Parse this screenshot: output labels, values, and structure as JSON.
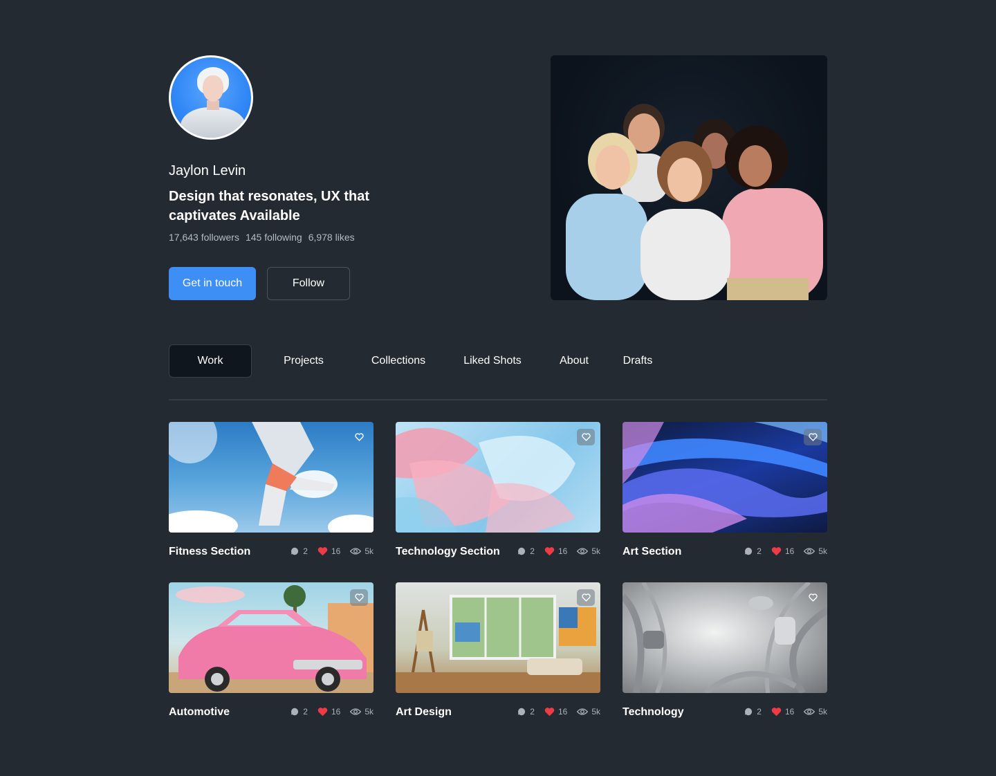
{
  "profile": {
    "name": "Jaylon Levin",
    "tagline": "Design that resonates, UX that captivates Available",
    "followers": "17,643 followers",
    "following": "145 following",
    "likes": "6,978 likes",
    "primary_button": "Get in touch",
    "secondary_button": "Follow"
  },
  "tabs": [
    "Work",
    "Projects",
    "Collections",
    "Liked Shots",
    "About",
    "Drafts"
  ],
  "active_tab": "Work",
  "cards": [
    {
      "title": "Fitness Section",
      "comments": "2",
      "likes": "16",
      "views": "5k"
    },
    {
      "title": "Technology Section",
      "comments": "2",
      "likes": "16",
      "views": "5k"
    },
    {
      "title": "Art Section",
      "comments": "2",
      "likes": "16",
      "views": "5k"
    },
    {
      "title": "Automotive",
      "comments": "2",
      "likes": "16",
      "views": "5k"
    },
    {
      "title": "Art Design",
      "comments": "2",
      "likes": "16",
      "views": "5k"
    },
    {
      "title": "Technology",
      "comments": "2",
      "likes": "16",
      "views": "5k"
    }
  ],
  "colors": {
    "background": "#232a31",
    "accent": "#3d8ef5",
    "heart": "#ef3b45",
    "muted_text": "#aab2bb"
  },
  "icons": [
    "comment-icon",
    "heart-icon",
    "eye-icon",
    "heart-outline-icon"
  ]
}
